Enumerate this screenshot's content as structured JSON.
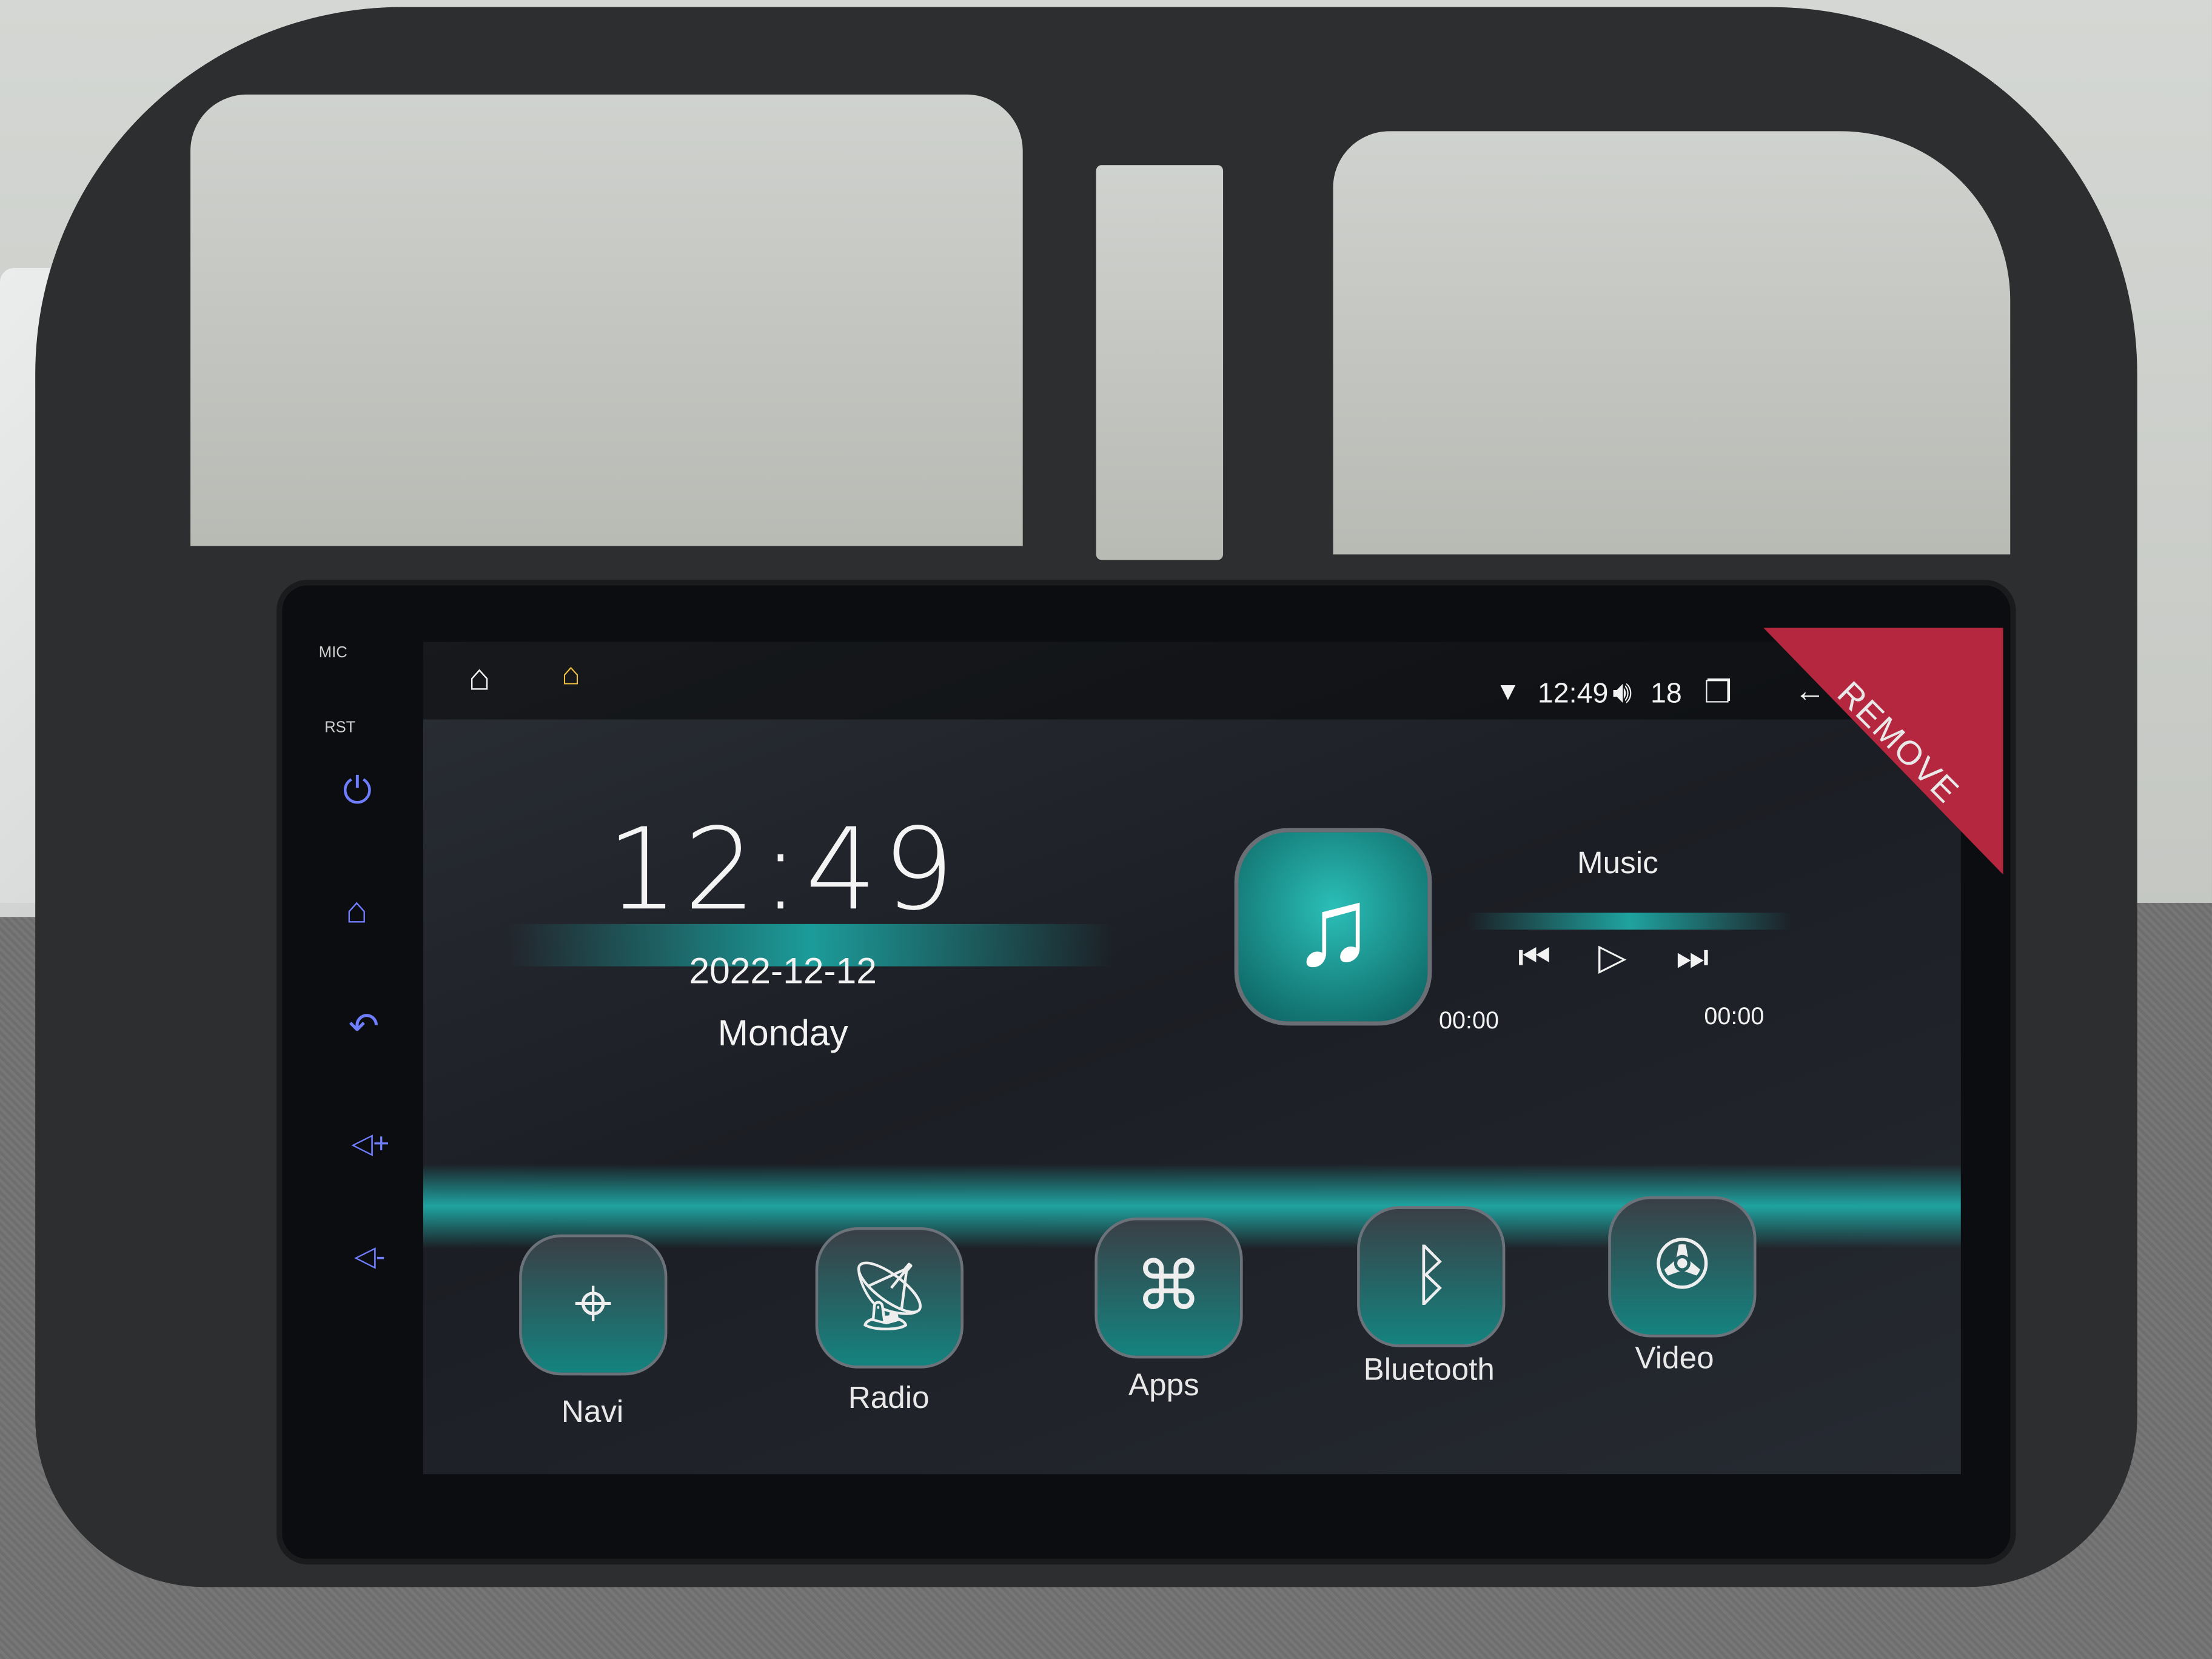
{
  "status_bar": {
    "time": "12:49",
    "volume": "18",
    "icons": [
      "home-outline-icon",
      "launcher-icon",
      "wifi-icon",
      "volume-icon",
      "recents-icon",
      "back-icon"
    ]
  },
  "side_buttons": {
    "mic": "MIC",
    "rst": "RST",
    "icons": [
      "power-icon",
      "home-icon",
      "back-icon",
      "volume-up-icon",
      "volume-down-icon"
    ]
  },
  "sticker": "REMOVE",
  "clock": {
    "time": "12:49",
    "date": "2022-12-12",
    "weekday": "Monday"
  },
  "music": {
    "title": "Music",
    "elapsed": "00:00",
    "duration": "00:00"
  },
  "apps": [
    {
      "label": "Navi"
    },
    {
      "label": "Radio"
    },
    {
      "label": "Apps"
    },
    {
      "label": "Bluetooth"
    },
    {
      "label": "Video"
    }
  ],
  "colors": {
    "accent": "#1fa3a0",
    "sticker": "#b5273f",
    "side_buttons": "#6f7dff"
  }
}
